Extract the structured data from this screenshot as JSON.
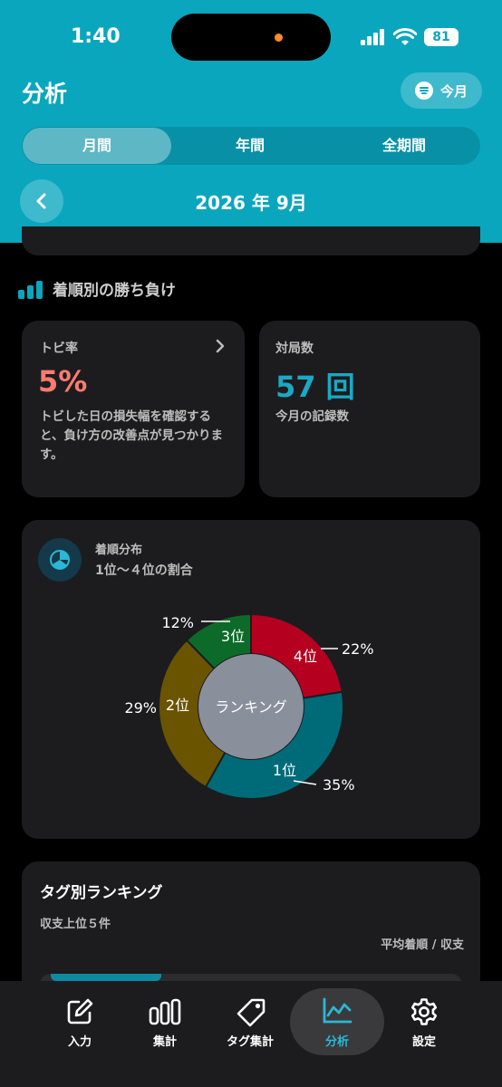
{
  "status": {
    "time": "1:40",
    "battery": "81"
  },
  "header": {
    "title": "分析",
    "month_button": "今月",
    "tabs": [
      {
        "label": "月間",
        "active": true
      },
      {
        "label": "年間"
      },
      {
        "label": "全期間"
      }
    ],
    "period": "2026 年 9月"
  },
  "section": {
    "title": "着順別の勝ち負け"
  },
  "tobi": {
    "label": "トビ率",
    "value": "5%",
    "description": "トビした日の損失幅を確認すると、負け方の改善点が見つかります。"
  },
  "games": {
    "label": "対局数",
    "value": "57 回",
    "sub": "今月の記録数"
  },
  "distribution": {
    "title": "着順分布",
    "subtitle": "1位〜４位の割合",
    "center_label": "ランキング"
  },
  "chart_data": {
    "type": "pie",
    "title": "着順分布",
    "subtitle": "1位〜４位の割合",
    "center_label": "ランキング",
    "slices": [
      {
        "label": "4位",
        "value": 22,
        "pct_label": "22%",
        "color": "#b6001f"
      },
      {
        "label": "1位",
        "value": 35,
        "pct_label": "35%",
        "color": "#006b78"
      },
      {
        "label": "2位",
        "value": 29,
        "pct_label": "29%",
        "color": "#6b5400"
      },
      {
        "label": "3位",
        "value": 12,
        "pct_label": "12%",
        "color": "#0d6b2a"
      }
    ]
  },
  "tag_ranking": {
    "title": "タグ別ランキング",
    "subtitle": "収支上位５件",
    "column_label": "平均着順 / 収支"
  },
  "tabbar": {
    "items": [
      {
        "label": "入力",
        "icon": "edit-icon"
      },
      {
        "label": "集計",
        "icon": "bar-chart-icon"
      },
      {
        "label": "タグ集計",
        "icon": "tag-icon"
      },
      {
        "label": "分析",
        "icon": "analysis-chart-icon",
        "active": true
      },
      {
        "label": "設定",
        "icon": "gear-icon"
      }
    ]
  },
  "colors": {
    "accent": "#0aa6be",
    "tobi": "#ff7b70",
    "games": "#1aa9c4",
    "card": "#1c1c1e"
  }
}
